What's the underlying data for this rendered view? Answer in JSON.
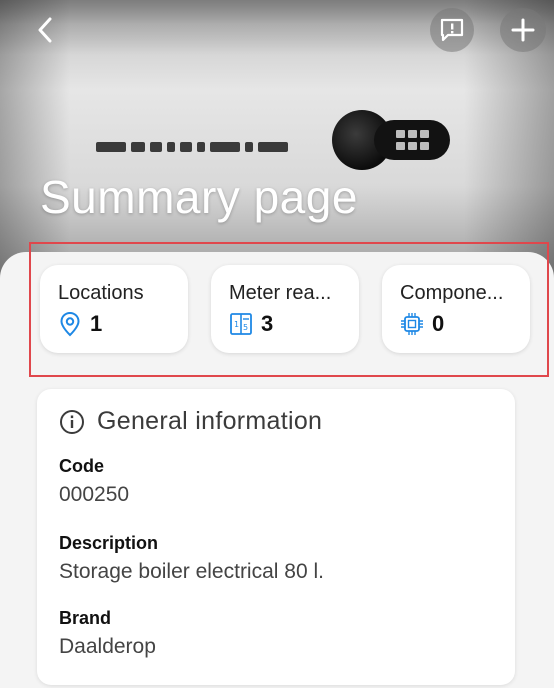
{
  "header": {
    "title": "Summary page"
  },
  "icons": {
    "back": "chevron-left-icon",
    "feedback": "feedback-icon",
    "add": "plus-icon"
  },
  "stats": {
    "locations": {
      "label": "Locations",
      "value": "1",
      "icon": "location-pin-icon"
    },
    "meter_readings": {
      "label": "Meter rea...",
      "value": "3",
      "icon": "meter-icon"
    },
    "components": {
      "label": "Compone...",
      "value": "0",
      "icon": "chip-icon"
    }
  },
  "general_info": {
    "title": "General information",
    "fields": [
      {
        "label": "Code",
        "value": "000250"
      },
      {
        "label": "Description",
        "value": "Storage boiler electrical 80 l."
      },
      {
        "label": "Brand",
        "value": "Daalderop"
      }
    ]
  },
  "colors": {
    "accent_blue": "#1e88e5",
    "highlight_red": "#e0474c"
  }
}
